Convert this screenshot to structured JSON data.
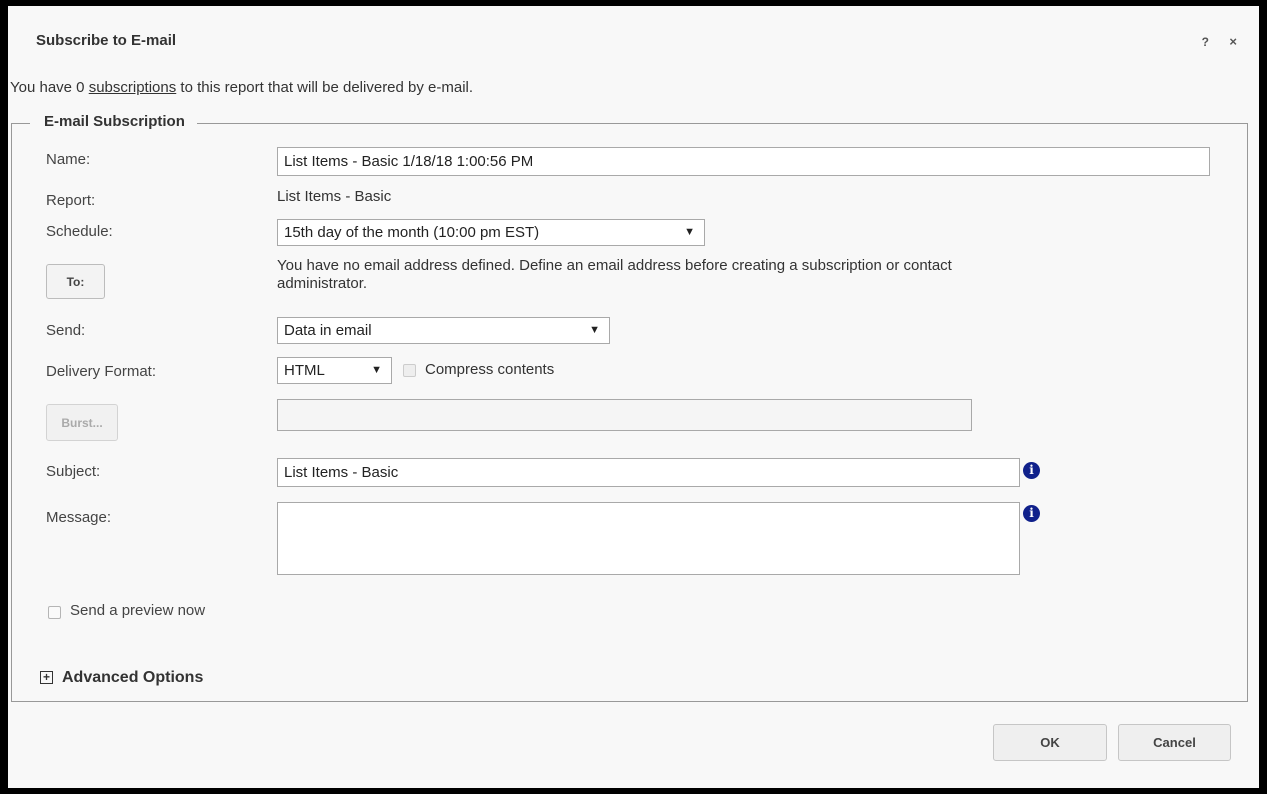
{
  "dialog": {
    "title": "Subscribe to E-mail",
    "help_label": "?",
    "close_label": "×"
  },
  "intro": {
    "prefix": "You have 0",
    "link": "subscriptions",
    "suffix": "to this report that will be delivered by e-mail."
  },
  "fieldset": {
    "legend": "E-mail Subscription"
  },
  "form": {
    "name_label": "Name:",
    "name_value": "List Items - Basic 1/18/18 1:00:56 PM",
    "report_label": "Report:",
    "report_value": "List Items - Basic",
    "schedule_label": "Schedule:",
    "schedule_value": "15th day of the month (10:00 pm EST)",
    "to_button": "To:",
    "to_message_line1": "You have no email address defined. Define an email address before creating a subscription or contact",
    "to_message_line2": "administrator.",
    "send_label": "Send:",
    "send_value": "Data in email",
    "format_label": "Delivery Format:",
    "format_value": "HTML",
    "compress_label": "Compress contents",
    "compress_checked": false,
    "burst_button": "Burst...",
    "burst_value": "",
    "subject_label": "Subject:",
    "subject_value": "List Items - Basic",
    "message_label": "Message:",
    "message_value": "",
    "preview_label": "Send a preview now",
    "preview_checked": false,
    "advanced_label": "Advanced Options",
    "advanced_toggle": "+"
  },
  "footer": {
    "ok": "OK",
    "cancel": "Cancel"
  },
  "colors": {
    "info_icon": "#10218b",
    "dialog_bg": "#f8f8f8",
    "frame": "#000000"
  },
  "icons": {
    "info": "info-icon",
    "dropdown": "chevron-down-icon",
    "expand": "plus-box-icon"
  }
}
